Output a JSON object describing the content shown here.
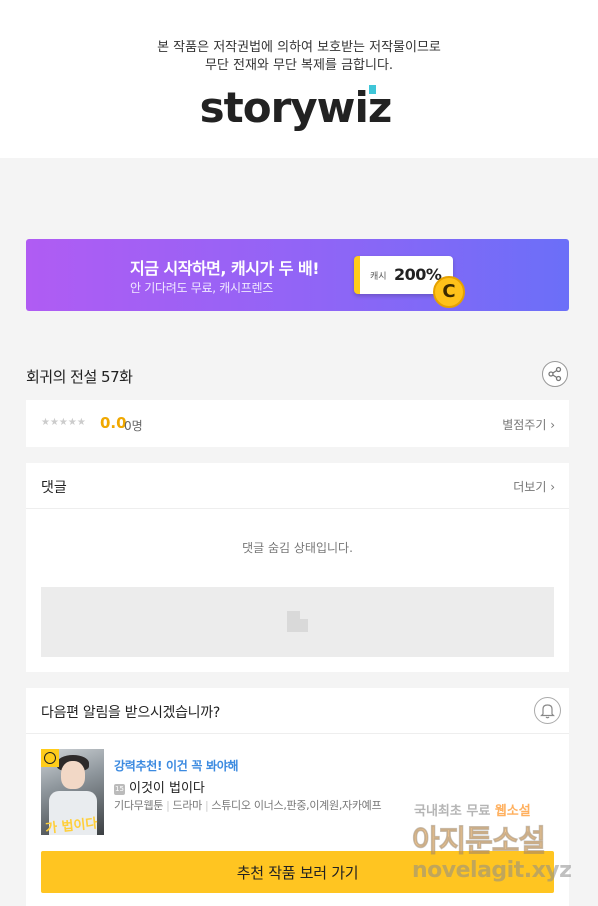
{
  "header": {
    "copyright_line1": "본 작품은 저작권법에 의하여 보호받는 저작물이므로",
    "copyright_line2": "무단 전재와 무단 복제를 금합니다.",
    "logo": "storywiz"
  },
  "banner": {
    "title": "지금 시작하면, 캐시가 두 배!",
    "subtitle": "안 기다려도 무료, 캐시프렌즈",
    "cash_label": "캐시",
    "cash_value": "200%",
    "coin_letter": "C"
  },
  "episode": {
    "title": "회귀의 전설 57화",
    "share_icon": "share-icon"
  },
  "rating": {
    "stars": "★★★★★",
    "score": "0.0",
    "count": "0명",
    "rate_label": "별점주기 ›"
  },
  "comments": {
    "title": "댓글",
    "more_label": "더보기 ›",
    "hidden_message": "댓글 숨김 상태입니다."
  },
  "notify": {
    "question": "다음편 알림을 받으시겠습니까?",
    "bell_icon": "bell-icon",
    "recommend_tag": "강력추천! 이건 꼭 봐야해",
    "age_badge": "15",
    "recommend_title": "이것이 법이다",
    "meta": [
      "기다무웹툰",
      "드라마",
      "스튜디오 이너스,판중,이계원,자카예프"
    ],
    "thumb_text": "가 법이다",
    "button_label": "추천 작품 보러 가기"
  },
  "watermark": {
    "line1_a": "국내최초 무료 ",
    "line1_b": "웹소설",
    "line2": "아지툰소설",
    "line3": "novelagit.xyz"
  },
  "colors": {
    "accent_yellow": "#ffc521",
    "banner_start": "#b05cf3",
    "banner_end": "#6b6ff8",
    "score": "#f0a800",
    "link_blue": "#3b8ae0"
  }
}
